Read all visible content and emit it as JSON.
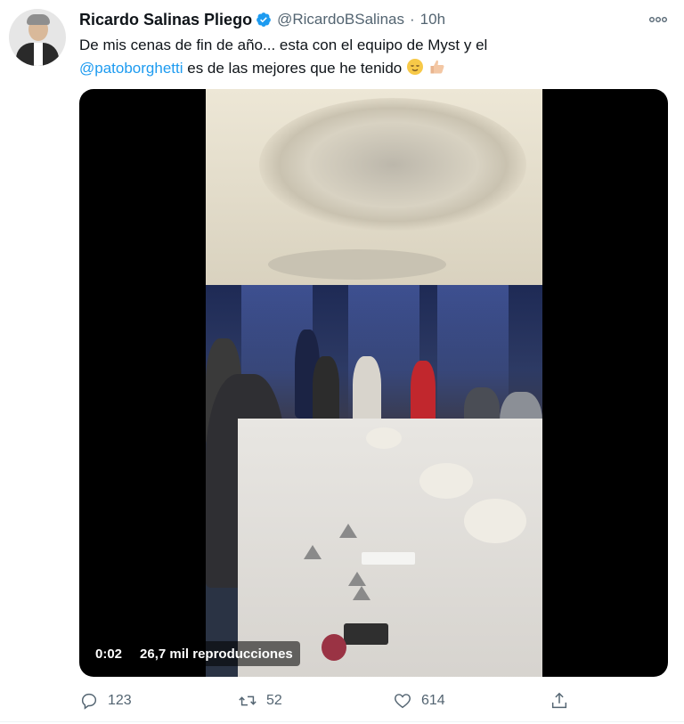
{
  "author": {
    "name": "Ricardo Salinas Pliego",
    "handle": "@RicardoBSalinas",
    "separator": "·",
    "time": "10h",
    "verified_icon": "verified-badge-icon"
  },
  "tweet": {
    "text_part1": "De mis cenas de fin de año... esta con el equipo de Myst y el",
    "mention": "@patoborghetti",
    "text_part2": " es de las mejores que he tenido ",
    "emojis": [
      "relieved-face-emoji",
      "thumbs-up-emoji"
    ]
  },
  "video": {
    "timestamp": "0:02",
    "views": "26,7 mil reproducciones"
  },
  "actions": {
    "replies": "123",
    "retweets": "52",
    "likes": "614"
  },
  "colors": {
    "accent": "#1d9bf0",
    "secondary_text": "#536471",
    "primary_text": "#0f1419"
  }
}
